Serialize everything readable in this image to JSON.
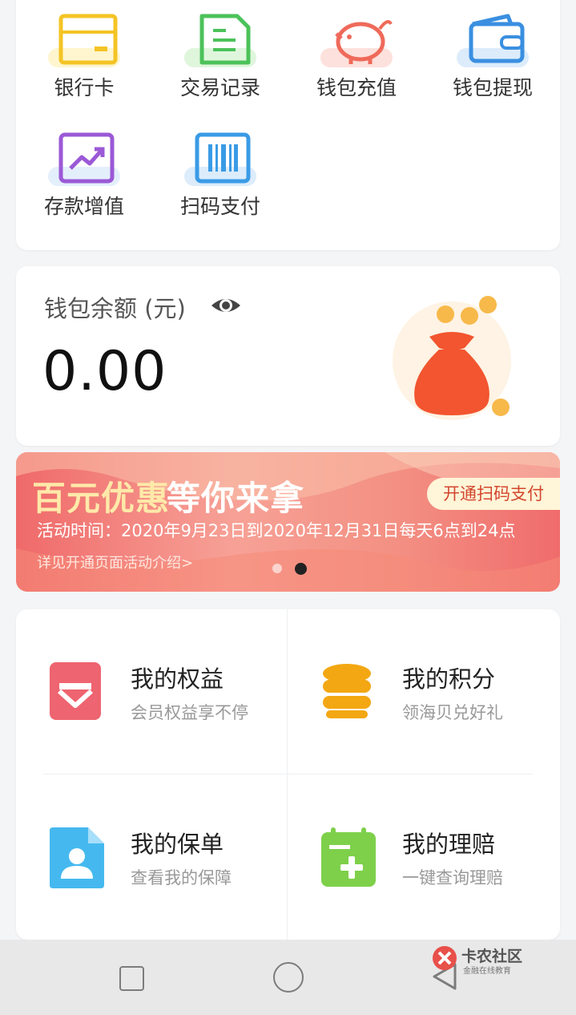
{
  "services": [
    {
      "label": "银行卡",
      "icon": "bank-card-icon",
      "color": "#f4c425"
    },
    {
      "label": "交易记录",
      "icon": "transaction-record-icon",
      "color": "#4cc25a"
    },
    {
      "label": "钱包充值",
      "icon": "piggy-bank-icon",
      "color": "#ef6a5a"
    },
    {
      "label": "钱包提现",
      "icon": "wallet-icon",
      "color": "#3a8fe0"
    },
    {
      "label": "存款增值",
      "icon": "trend-chart-icon",
      "color": "#9b59d6"
    },
    {
      "label": "扫码支付",
      "icon": "barcode-icon",
      "color": "#3a9be6"
    }
  ],
  "wallet": {
    "title": "钱包余额 (元)",
    "amount": "0.00"
  },
  "banner": {
    "title_highlight": "百元优惠",
    "title_rest": "等你来拿",
    "cta": "开通扫码支付",
    "time": "活动时间：2020年9月23日到2020年12月31日每天6点到24点",
    "link": "详见开通页面活动介绍>"
  },
  "benefits": [
    {
      "title": "我的权益",
      "subtitle": "会员权益享不停",
      "icon": "rights-gift-icon",
      "color": "#ee6470"
    },
    {
      "title": "我的积分",
      "subtitle": "领海贝兑好礼",
      "icon": "coins-icon",
      "color": "#f3a712"
    },
    {
      "title": "我的保单",
      "subtitle": "查看我的保障",
      "icon": "policy-document-icon",
      "color": "#45b9ef"
    },
    {
      "title": "我的理赔",
      "subtitle": "一键查询理赔",
      "icon": "claim-calendar-icon",
      "color": "#7ed04b"
    }
  ],
  "watermark": {
    "name": "卡农社区",
    "tagline": "金融在线教育"
  }
}
